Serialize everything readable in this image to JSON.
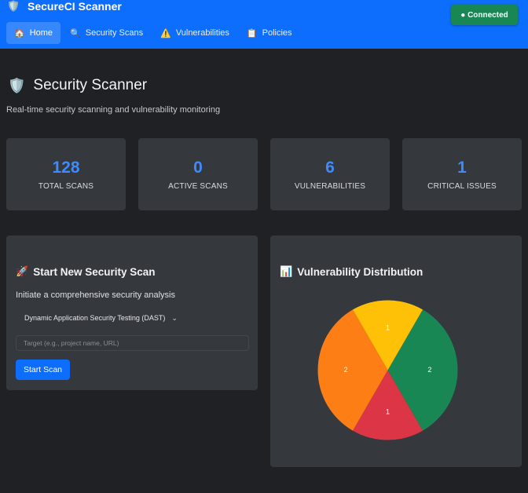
{
  "app": {
    "title": "SecureCI Scanner",
    "logo_icon": "🛡️",
    "status": "● Connected",
    "status_color": "#198754",
    "accent": "#0d6efd"
  },
  "nav": {
    "items": [
      {
        "icon": "🏠",
        "label": "Home",
        "active": true
      },
      {
        "icon": "🔍",
        "label": "Security Scans",
        "active": false
      },
      {
        "icon": "⚠️",
        "label": "Vulnerabilities",
        "active": false
      },
      {
        "icon": "📋",
        "label": "Policies",
        "active": false
      }
    ]
  },
  "header": {
    "icon": "🛡️",
    "title": "Security Scanner",
    "subtitle": "Real-time security scanning and vulnerability monitoring"
  },
  "stats": [
    {
      "value": "128",
      "label": "TOTAL SCANS"
    },
    {
      "value": "0",
      "label": "ACTIVE SCANS"
    },
    {
      "value": "6",
      "label": "VULNERABILITIES"
    },
    {
      "value": "1",
      "label": "CRITICAL ISSUES"
    }
  ],
  "scan_card": {
    "icon": "🚀",
    "title": "Start New Security Scan",
    "description": "Initiate a comprehensive security analysis",
    "scan_type": "Dynamic Application Security Testing (DAST)",
    "target_placeholder": "Target (e.g., project name, URL)",
    "target_value": "",
    "start_button": "Start Scan"
  },
  "chart_card": {
    "icon": "📊",
    "title": "Vulnerability Distribution"
  },
  "chart_data": {
    "type": "pie",
    "title": "Vulnerability Distribution",
    "slices": [
      {
        "value": 2,
        "label": "2",
        "color": "#198754"
      },
      {
        "value": 1,
        "label": "1",
        "color": "#dc3545"
      },
      {
        "value": 2,
        "label": "2",
        "color": "#fd7e14"
      },
      {
        "value": 1,
        "label": "1",
        "color": "#ffc107"
      }
    ],
    "start_angle_deg": -60,
    "direction": "clockwise"
  }
}
